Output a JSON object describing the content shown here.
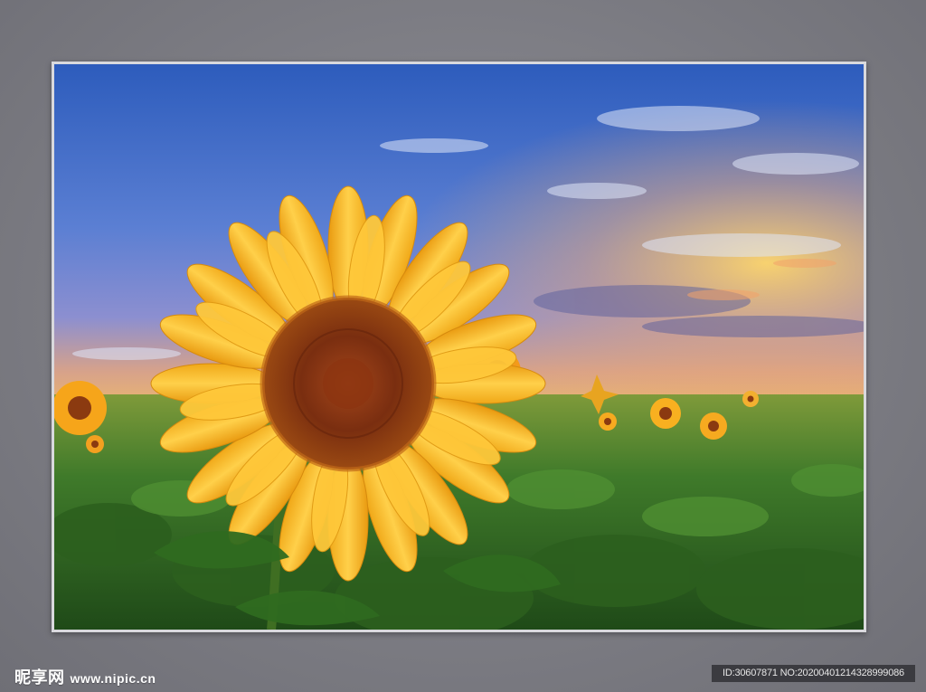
{
  "watermark": {
    "logo_cn": "昵享网",
    "logo_url": "www.nipic.cn"
  },
  "image_id": {
    "text": "ID:30607871 NO:20200401214328999086"
  },
  "scene": {
    "sky_top": "#2f5fbf",
    "sky_mid": "#6a88d6",
    "horizon_glow": "#f4b45a",
    "petal_color": "#f6b21c",
    "center_color": "#7a2e10",
    "foliage_color": "#3f7a2a"
  }
}
